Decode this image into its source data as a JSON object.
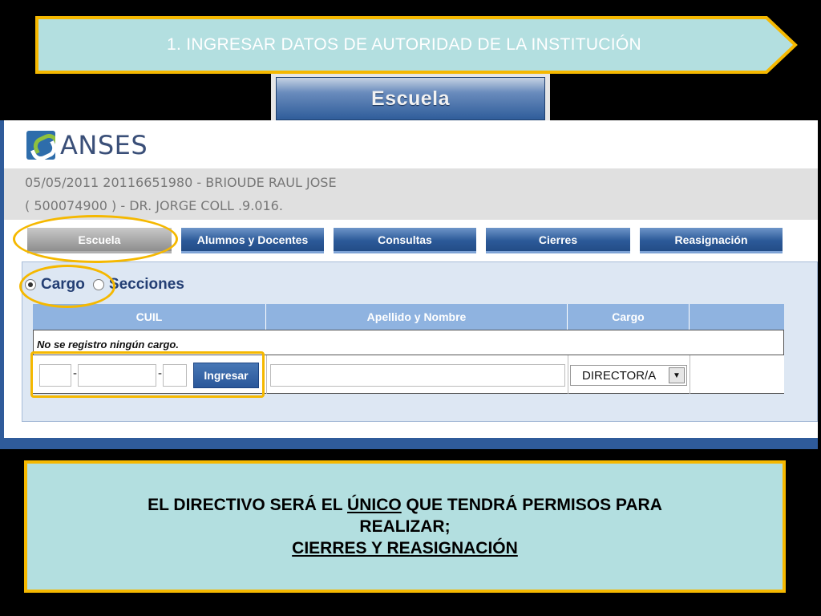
{
  "banner": {
    "text": "1. INGRESAR DATOS DE AUTORIDAD DE LA INSTITUCIÓN"
  },
  "section_header": {
    "label": "Escuela"
  },
  "app": {
    "logo_text": "ANSES",
    "info_line1": "05/05/2011  20116651980 - BRIOUDE RAUL JOSE",
    "info_line2": "( 500074900 ) - DR. JORGE COLL .9.016."
  },
  "tabs": [
    {
      "label": "Escuela",
      "active": true
    },
    {
      "label": "Alumnos y Docentes",
      "active": false
    },
    {
      "label": "Consultas",
      "active": false
    },
    {
      "label": "Cierres",
      "active": false
    },
    {
      "label": "Reasignación",
      "active": false
    }
  ],
  "radios": [
    {
      "label": "Cargo",
      "checked": true
    },
    {
      "label": "Secciones",
      "checked": false
    }
  ],
  "grid": {
    "headers": [
      "CUIL",
      "Apellido y Nombre",
      "Cargo",
      ""
    ],
    "empty_message": "No se registro ningún cargo.",
    "cuil_part1": "",
    "cuil_part2": "",
    "cuil_part3": "",
    "name_value": "",
    "ingresar_label": "Ingresar",
    "cargo_selected": "DIRECTOR/A"
  },
  "note": {
    "line1_a": "EL DIRECTIVO SERÁ EL ",
    "line1_b": "ÚNICO",
    "line1_c": " QUE TENDRÁ PERMISOS PARA",
    "line2": "REALIZAR;",
    "line3": "CIERRES Y REASIGNACIÓN"
  },
  "colors": {
    "highlight": "#f5b800",
    "banner_fill": "#b3dfe0",
    "tab_blue": "#2c5a99"
  }
}
